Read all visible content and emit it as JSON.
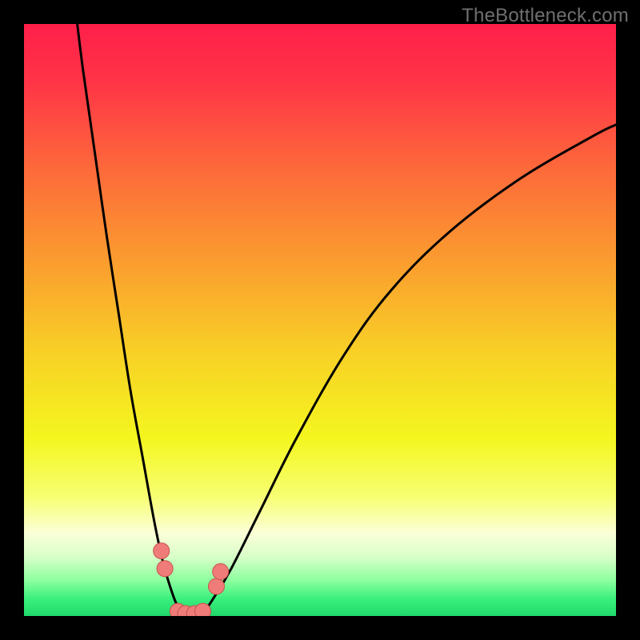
{
  "watermark": "TheBottleneck.com",
  "chart_data": {
    "type": "line",
    "title": "",
    "xlabel": "",
    "ylabel": "",
    "xlim": [
      0,
      100
    ],
    "ylim": [
      0,
      100
    ],
    "grid": false,
    "legend": false,
    "series": [
      {
        "name": "left-curve",
        "x": [
          9,
          10,
          12,
          14,
          16,
          18,
          20,
          22,
          23.5,
          25,
          26,
          27
        ],
        "y": [
          100,
          92,
          78,
          64,
          51,
          38,
          27,
          16,
          9,
          4,
          1.5,
          0
        ]
      },
      {
        "name": "right-curve",
        "x": [
          30,
          32,
          35,
          40,
          46,
          54,
          62,
          72,
          84,
          96,
          100
        ],
        "y": [
          0,
          3,
          8,
          18,
          30,
          44,
          55,
          65,
          74,
          81,
          83
        ]
      }
    ],
    "markers": [
      {
        "name": "marker-left-a",
        "x": 23.2,
        "y": 11.0
      },
      {
        "name": "marker-left-b",
        "x": 23.8,
        "y": 8.0
      },
      {
        "name": "marker-bottom-a",
        "x": 26.0,
        "y": 0.8
      },
      {
        "name": "marker-bottom-b",
        "x": 27.3,
        "y": 0.4
      },
      {
        "name": "marker-bottom-c",
        "x": 28.8,
        "y": 0.4
      },
      {
        "name": "marker-bottom-d",
        "x": 30.2,
        "y": 0.8
      },
      {
        "name": "marker-right-a",
        "x": 32.5,
        "y": 5.0
      },
      {
        "name": "marker-right-b",
        "x": 33.2,
        "y": 7.5
      }
    ],
    "gradient_stops": [
      {
        "offset": 0.0,
        "color": "#ff1f4a"
      },
      {
        "offset": 0.1,
        "color": "#ff3547"
      },
      {
        "offset": 0.25,
        "color": "#fd6b3a"
      },
      {
        "offset": 0.4,
        "color": "#fb9c2f"
      },
      {
        "offset": 0.55,
        "color": "#f8cf26"
      },
      {
        "offset": 0.7,
        "color": "#f4f61f"
      },
      {
        "offset": 0.8,
        "color": "#f7ff74"
      },
      {
        "offset": 0.86,
        "color": "#fbffd8"
      },
      {
        "offset": 0.9,
        "color": "#d8ffc8"
      },
      {
        "offset": 0.94,
        "color": "#8cff9f"
      },
      {
        "offset": 0.97,
        "color": "#3cf07d"
      },
      {
        "offset": 1.0,
        "color": "#1fd96b"
      }
    ],
    "marker_fill": "#ef7c78",
    "marker_stroke": "#c9504c",
    "curve_color": "#000000",
    "curve_width": 3,
    "marker_radius": 10
  }
}
